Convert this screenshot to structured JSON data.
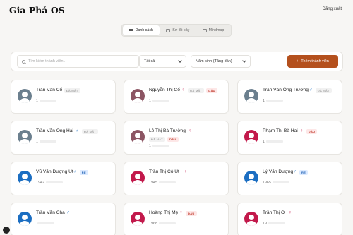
{
  "header": {
    "brand": "Gia Phả OS",
    "logout": "Đăng xuất"
  },
  "tabs": [
    {
      "label": "Danh sách",
      "icon": "list-icon",
      "active": true
    },
    {
      "label": "Sơ đồ cây",
      "icon": "tree-icon",
      "active": false
    },
    {
      "label": "Mindmap",
      "icon": "mindmap-icon",
      "active": false
    }
  ],
  "filters": {
    "search_placeholder": "Tìm kiếm thành viên...",
    "status_select": "Tất cả",
    "sort_select": "Năm sinh (Tăng dần)",
    "add_button": "Thêm thành viên"
  },
  "colors": {
    "male": "#1b6ec2",
    "female": "#c2194b",
    "deceased_male": "#6b7f8e",
    "deceased_female": "#8c5563",
    "accent": "#b4501d"
  },
  "members": [
    {
      "name": "Trần Văn Cổ",
      "gender": "",
      "badges": [
        "ĐÃ MẤT"
      ],
      "year": "1",
      "avatar": "deceased_male"
    },
    {
      "name": "Nguyễn Thị Cổ",
      "gender": "♀",
      "badges": [
        "ĐÃ MẤT",
        "DÂU"
      ],
      "year": "1",
      "avatar": "deceased_female"
    },
    {
      "name": "Trần Văn Ông Trưởng",
      "gender": "♂",
      "badges": [
        "ĐÃ MẤT"
      ],
      "year": "1",
      "avatar": "deceased_male"
    },
    {
      "name": "Trần Văn Ông Hai",
      "gender": "♂",
      "badges": [
        "ĐÃ MẤT"
      ],
      "year": "1",
      "avatar": "deceased_male"
    },
    {
      "name": "Lê Thị Bà Trưởng",
      "gender": "♀",
      "badges": [
        "ĐÃ MẤT",
        "DÂU"
      ],
      "year": "1",
      "avatar": "deceased_female"
    },
    {
      "name": "Phạm Thị Bà Hai",
      "gender": "♀",
      "badges": [
        "DÂU"
      ],
      "year": "1",
      "avatar": "female"
    },
    {
      "name": "Vũ Văn Dượng Út",
      "gender": "♂",
      "badges": [
        "RỂ"
      ],
      "year": "1942",
      "avatar": "male"
    },
    {
      "name": "Trần Thị Cô Út",
      "gender": "♀",
      "badges": [],
      "year": "1945",
      "avatar": "female"
    },
    {
      "name": "Lý Văn Dượng",
      "gender": "♂",
      "badges": [
        "RỂ"
      ],
      "year": "1965",
      "avatar": "male"
    },
    {
      "name": "Trần Văn Cha",
      "gender": "♂",
      "badges": [],
      "year": "",
      "avatar": "male"
    },
    {
      "name": "Hoàng Thị Mẹ",
      "gender": "♀",
      "badges": [
        "DÂU"
      ],
      "year": "1968",
      "avatar": "female"
    },
    {
      "name": "Trần Thị O",
      "gender": "♀",
      "badges": [],
      "year": "19",
      "avatar": "female"
    }
  ]
}
